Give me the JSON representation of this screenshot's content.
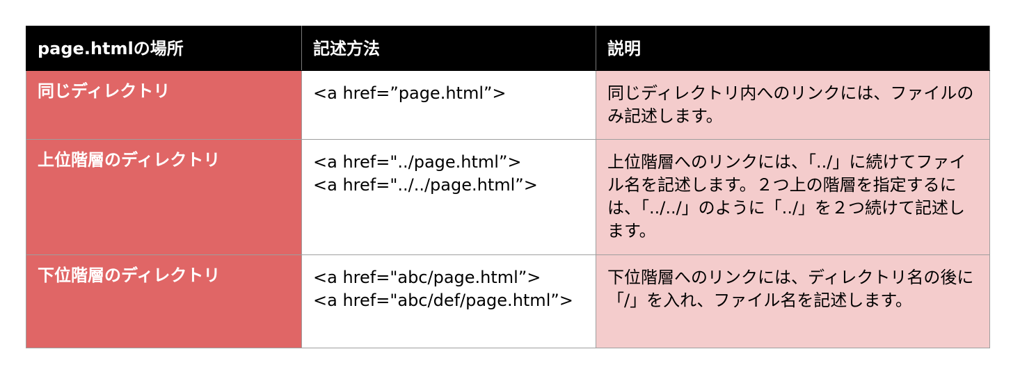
{
  "header": {
    "col1": "page.htmlの場所",
    "col2": "記述方法",
    "col3": "説明"
  },
  "rows": [
    {
      "location": "同じディレクトリ",
      "code": [
        "<a href=”page.html”>"
      ],
      "description": "同じディレクトリ内へのリンクには、ファイルのみ記述します。"
    },
    {
      "location": "上位階層のディレクトリ",
      "code": [
        "<a href=\"../page.html”>",
        "<a href=\"../../page.html”>"
      ],
      "description": "上位階層へのリンクには、「../」に続けてファイル名を記述します。２つ上の階層を指定するには、「../../」のように「../」を２つ続けて記述します。"
    },
    {
      "location": "下位階層のディレクトリ",
      "code": [
        "<a href=\"abc/page.html”>",
        "<a href=\"abc/def/page.html”>"
      ],
      "description": "下位階層へのリンクには、ディレクトリ名の後に「/」を入れ、ファイル名を記述します。"
    }
  ],
  "colors": {
    "header_bg": "#000000",
    "location_bg": "#e06666",
    "description_bg": "#f4cccc"
  }
}
